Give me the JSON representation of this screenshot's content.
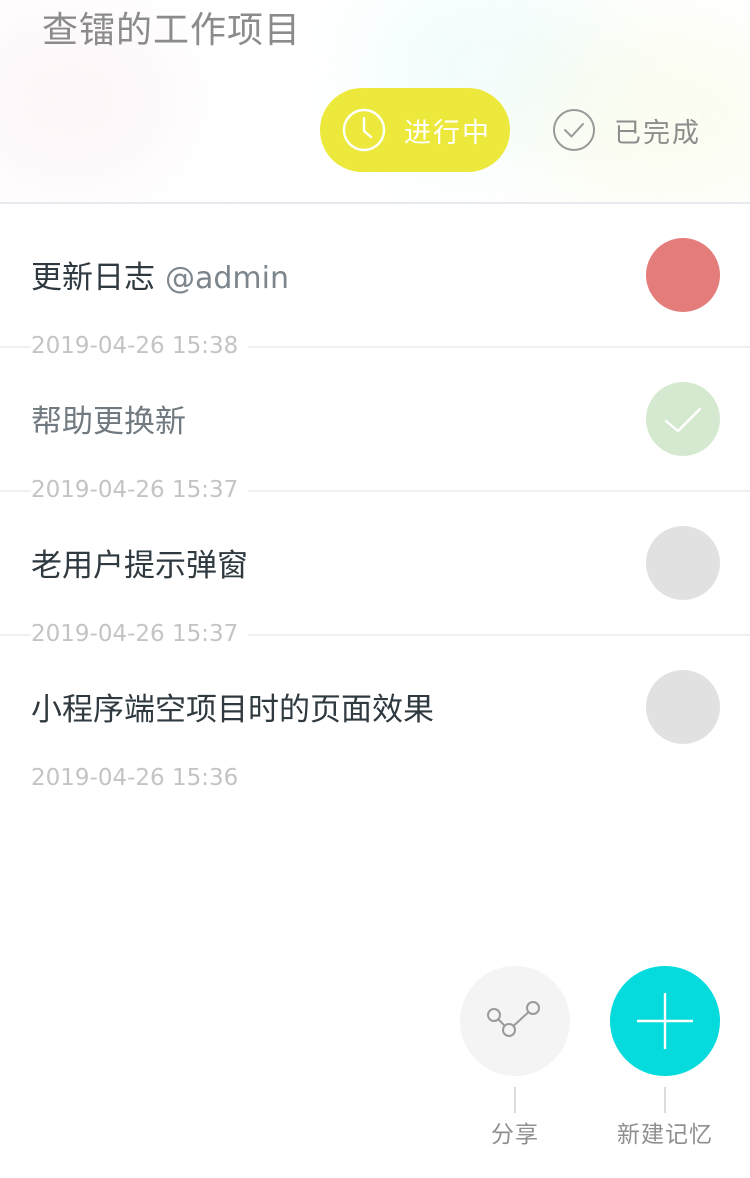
{
  "header": {
    "title": "查镭的工作项目",
    "tabs": {
      "active": {
        "label": "进行中",
        "icon": "clock-icon",
        "color": "#ece93c"
      },
      "inactive": {
        "label": "已完成",
        "icon": "check-circle-icon"
      }
    }
  },
  "tasks": [
    {
      "title": "更新日志",
      "mention": "@admin",
      "time": "2019-04-26 15:38",
      "status": "urgent",
      "status_color": "#e57c7c"
    },
    {
      "title": "帮助更换新",
      "time": "2019-04-26 15:37",
      "status": "done",
      "status_color": "#d5e9d0"
    },
    {
      "title": "老用户提示弹窗",
      "time": "2019-04-26 15:37",
      "status": "pending",
      "status_color": "#e1e1e1"
    },
    {
      "title": "小程序端空项目时的页面效果",
      "time": "2019-04-26 15:36",
      "status": "pending",
      "status_color": "#e1e1e1"
    }
  ],
  "actions": {
    "share": {
      "label": "分享",
      "icon": "share-icon"
    },
    "add": {
      "label": "新建记忆",
      "icon": "plus-icon",
      "color": "#05dbdc"
    }
  }
}
